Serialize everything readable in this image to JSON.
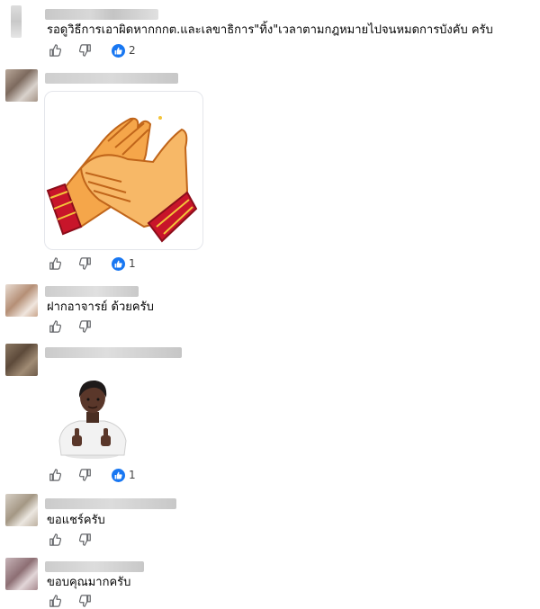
{
  "comments": [
    {
      "text": "รอดูวิธีการเอาผิดหากกกต.และเลขาธิการ\"ทิ้ง\"เวลาตามกฎหมายไปจนหมดการบังคับ ครับ",
      "reactions": "2"
    },
    {
      "text": "",
      "sticker": "clapping-hands-sticker",
      "reactions": "1"
    },
    {
      "text": "ฝากอาจารย์ ด้วยครับ",
      "reactions": ""
    },
    {
      "text": "",
      "sticker": "thumbs-up-person-sticker",
      "reactions": "1"
    },
    {
      "text": "ขอแชร์ครับ",
      "reactions": ""
    },
    {
      "text": "ขอบคุณมากครับ",
      "reactions": ""
    }
  ],
  "icons": {
    "like": "thumbs-up-icon",
    "dislike": "thumbs-down-icon",
    "reaction": "like-reaction-icon"
  },
  "colors": {
    "like_blue": "#1877f2",
    "icon_gray": "#65676b"
  }
}
